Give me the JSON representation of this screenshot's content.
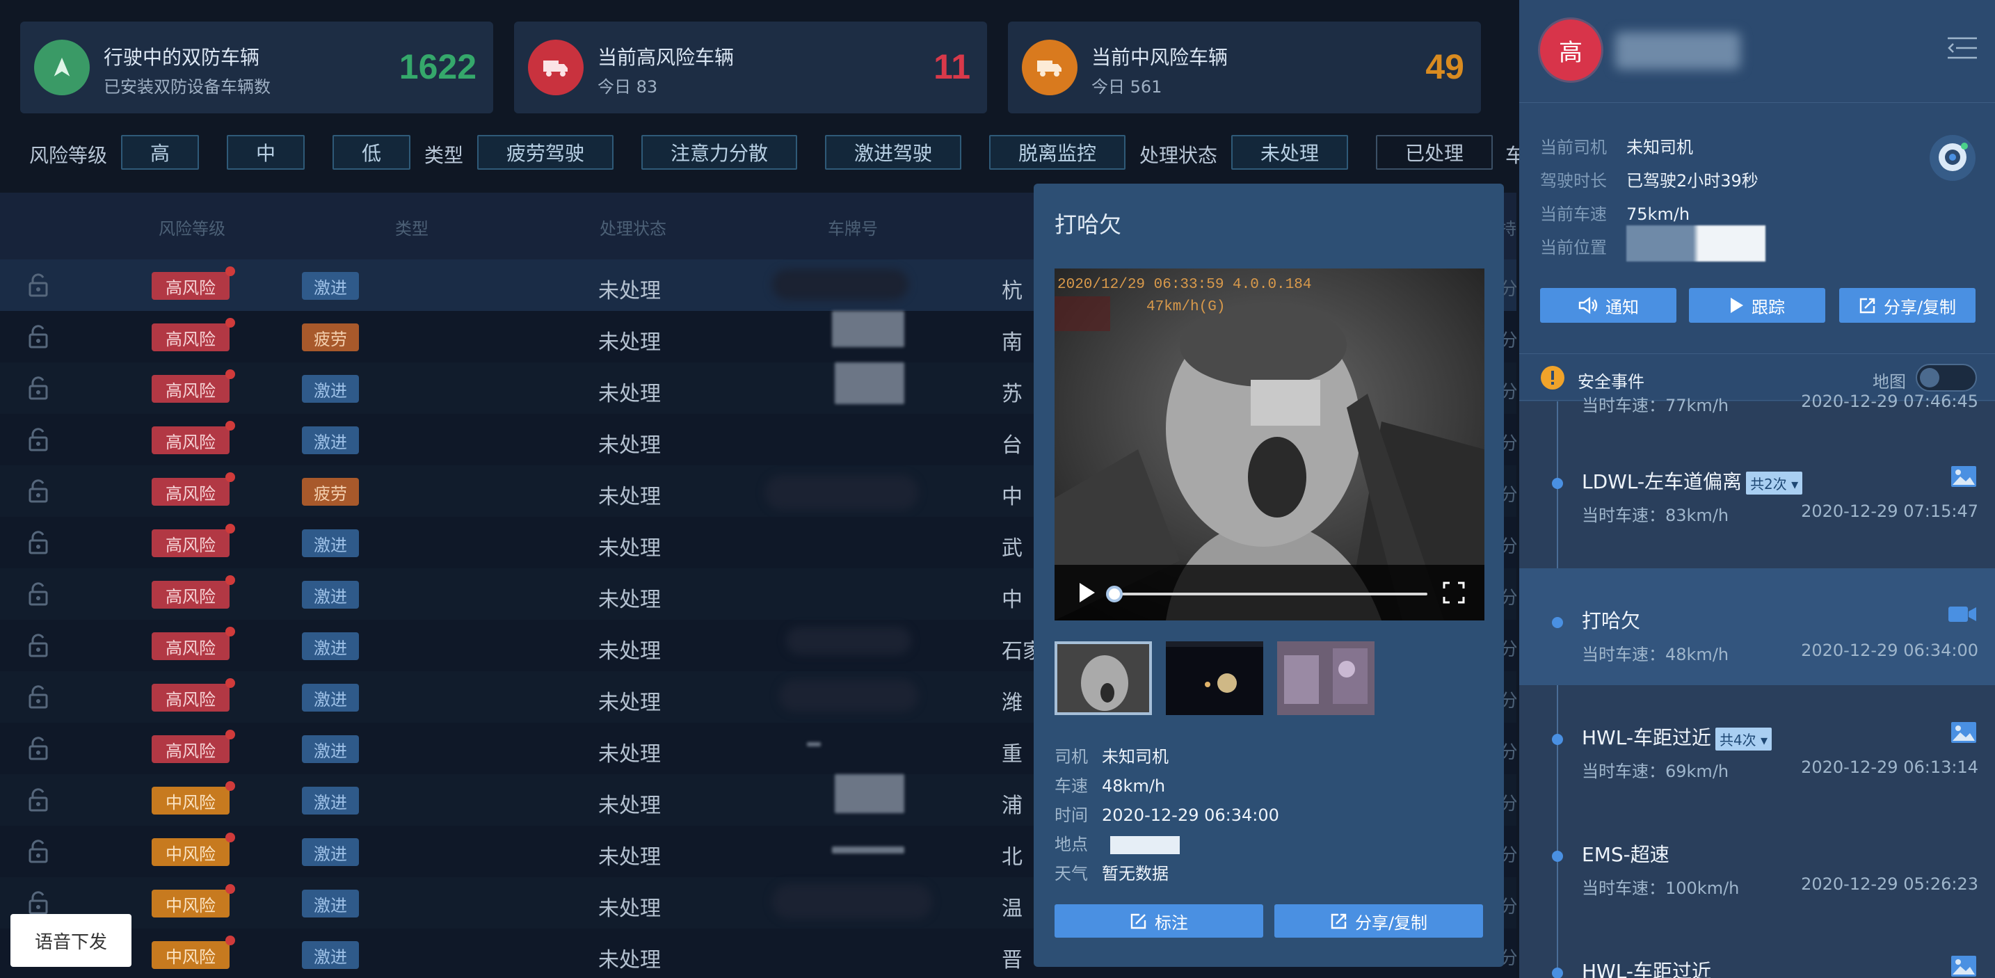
{
  "stats": [
    {
      "title": "行驶中的双防车辆",
      "sub": "已安装双防设备车辆数",
      "num": "1622",
      "color": "#3a9a66",
      "num_color": "#35a86b"
    },
    {
      "title": "当前高风险车辆",
      "sub": "今日 83",
      "num": "11",
      "color": "#c9323e",
      "num_color": "#d8394a"
    },
    {
      "title": "当前中风险车辆",
      "sub": "今日 561",
      "num": "49",
      "color": "#d97a1e",
      "num_color": "#d98b20"
    }
  ],
  "filters": {
    "risk_label": "风险等级",
    "risk_opts": [
      "高",
      "中",
      "低"
    ],
    "type_label": "类型",
    "type_opts": [
      "疲劳驾驶",
      "注意力分散",
      "激进驾驶",
      "脱离监控"
    ],
    "status_label": "处理状态",
    "status_opts": [
      "未处理",
      "已处理"
    ],
    "cut_label": "车"
  },
  "table": {
    "headers": [
      "风险等级",
      "类型",
      "处理状态",
      "车牌号"
    ],
    "tail_header": "持",
    "rows": [
      {
        "risk": "高风险",
        "type": "激进",
        "status": "未处理",
        "city": "杭"
      },
      {
        "risk": "高风险",
        "type": "疲劳",
        "status": "未处理",
        "city": "南"
      },
      {
        "risk": "高风险",
        "type": "激进",
        "status": "未处理",
        "city": "苏"
      },
      {
        "risk": "高风险",
        "type": "激进",
        "status": "未处理",
        "city": "台"
      },
      {
        "risk": "高风险",
        "type": "疲劳",
        "status": "未处理",
        "city": "中"
      },
      {
        "risk": "高风险",
        "type": "激进",
        "status": "未处理",
        "city": "武"
      },
      {
        "risk": "高风险",
        "type": "激进",
        "status": "未处理",
        "city": "中"
      },
      {
        "risk": "高风险",
        "type": "激进",
        "status": "未处理",
        "city": "石家"
      },
      {
        "risk": "高风险",
        "type": "激进",
        "status": "未处理",
        "city": "潍"
      },
      {
        "risk": "高风险",
        "type": "激进",
        "status": "未处理",
        "city": "重"
      },
      {
        "risk": "中风险",
        "type": "激进",
        "status": "未处理",
        "city": "浦"
      },
      {
        "risk": "中风险",
        "type": "激进",
        "status": "未处理",
        "city": "北"
      },
      {
        "risk": "中风险",
        "type": "激进",
        "status": "未处理",
        "city": "温"
      },
      {
        "risk": "中风险",
        "type": "激进",
        "status": "未处理",
        "city": "晋"
      }
    ],
    "tail_text": "分"
  },
  "voice_button": "语音下发",
  "popup": {
    "title": "打哈欠",
    "overlay_line1": "2020/12/29  06:33:59  4.0.0.184",
    "overlay_line2": "47km/h(G)",
    "info": [
      {
        "k": "司机",
        "v": "未知司机"
      },
      {
        "k": "车速",
        "v": "48km/h"
      },
      {
        "k": "时间",
        "v": "2020-12-29 06:34:00"
      },
      {
        "k": "地点",
        "v": ""
      },
      {
        "k": "天气",
        "v": "暂无数据"
      }
    ],
    "btn_mark": "标注",
    "btn_share": "分享/复制"
  },
  "right": {
    "avatar": "高",
    "info": [
      {
        "k": "当前司机",
        "v": "未知司机"
      },
      {
        "k": "驾驶时长",
        "v": "已驾驶2小时39秒"
      },
      {
        "k": "当前车速",
        "v": "75km/h"
      },
      {
        "k": "当前位置",
        "v": ""
      }
    ],
    "btn_notify": "通知",
    "btn_track": "跟踪",
    "btn_share": "分享/复制",
    "events_label": "安全事件",
    "map_label": "地图",
    "events_cut_top": {
      "spd": "当时车速：77km/h",
      "time": "2020-12-29 07:46:45"
    },
    "events": [
      {
        "name": "LDWL-左车道偏离",
        "count": "共2次",
        "spd": "当时车速：83km/h",
        "time": "2020-12-29 07:15:47",
        "icon": "image-icon"
      },
      {
        "name": "打哈欠",
        "count": "",
        "spd": "当时车速：48km/h",
        "time": "2020-12-29 06:34:00",
        "icon": "video-icon"
      },
      {
        "name": "HWL-车距过近",
        "count": "共4次",
        "spd": "当时车速：69km/h",
        "time": "2020-12-29 06:13:14",
        "icon": "image-icon"
      },
      {
        "name": "EMS-超速",
        "count": "",
        "spd": "当时车速：100km/h",
        "time": "2020-12-29 05:26:23",
        "icon": ""
      },
      {
        "name": "HWL-车距过近",
        "count": "",
        "spd": "",
        "time": "",
        "icon": "image-icon"
      }
    ]
  }
}
